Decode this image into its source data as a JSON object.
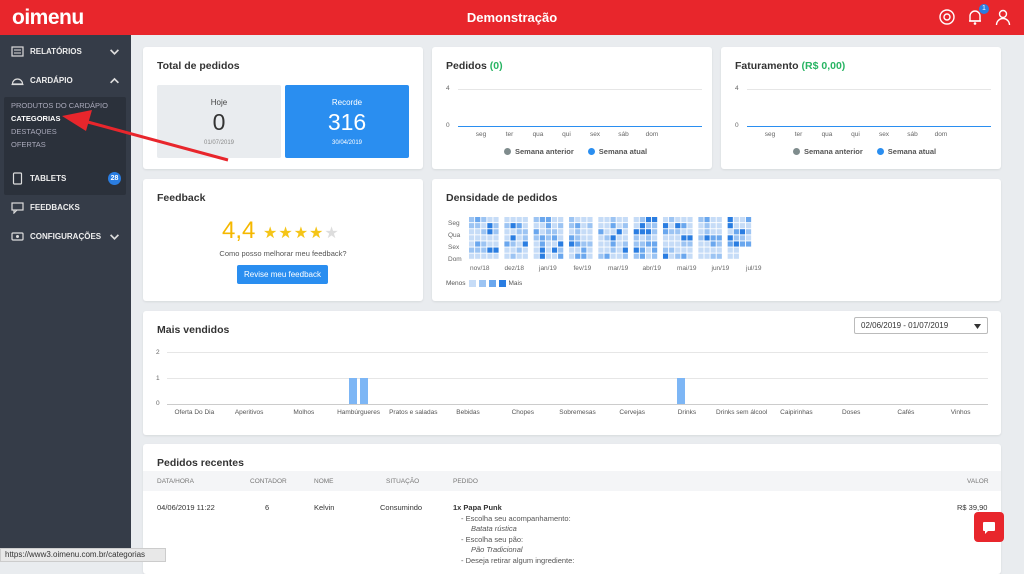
{
  "app": {
    "logo": "oimenu",
    "title": "Demonstração",
    "notification_count": "1"
  },
  "sidebar": {
    "relatorios": "RELATÓRIOS",
    "cardapio": "CARDÁPIO",
    "sub_items": [
      "PRODUTOS DO CARDÁPIO",
      "CATEGORIAS",
      "DESTAQUES",
      "OFERTAS"
    ],
    "tablets": "TABLETS",
    "tablets_badge": "28",
    "feedbacks": "FEEDBACKS",
    "configuracoes": "CONFIGURAÇÕES"
  },
  "total_pedidos": {
    "title": "Total de pedidos",
    "hoje": {
      "label": "Hoje",
      "value": "0",
      "date": "01/07/2019"
    },
    "recorde": {
      "label": "Recorde",
      "value": "316",
      "date": "30/04/2019"
    }
  },
  "pedidos": {
    "title": "Pedidos",
    "count": "(0)",
    "y_top": "4",
    "y_bottom": "0",
    "days": [
      "seg",
      "ter",
      "qua",
      "qui",
      "sex",
      "sáb",
      "dom"
    ],
    "legend": [
      "Semana anterior",
      "Semana atual"
    ]
  },
  "faturamento": {
    "title": "Faturamento",
    "value": "(R$ 0,00)",
    "y_top": "4",
    "y_bottom": "0",
    "days": [
      "seg",
      "ter",
      "qua",
      "qui",
      "sex",
      "sáb",
      "dom"
    ],
    "legend": [
      "Semana anterior",
      "Semana atual"
    ]
  },
  "feedback": {
    "title": "Feedback",
    "score": "4,4",
    "rating": 4.4,
    "prompt": "Como posso melhorar meu feedback?",
    "button": "Revise meu feedback"
  },
  "densidade": {
    "title": "Densidade de pedidos",
    "rows": [
      "Seg",
      "Qua",
      "Sex",
      "Dom"
    ],
    "months": [
      "nov/18",
      "dez/18",
      "jan/19",
      "fev/19",
      "mar/19",
      "abr/19",
      "mai/19",
      "jun/19",
      "jul/19"
    ],
    "legend_less": "Menos",
    "legend_more": "Mais"
  },
  "mais_vendidos": {
    "title": "Mais vendidos",
    "date_range": "02/06/2019 - 01/07/2019",
    "y_ticks": [
      "2",
      "1",
      "0"
    ],
    "categories": [
      "Oferta Do Dia",
      "Aperitivos",
      "Molhos",
      "Hambúrgueres",
      "Pratos e saladas",
      "Bebidas",
      "Chopes",
      "Sobremesas",
      "Cervejas",
      "Drinks",
      "Drinks sem álcool",
      "Caipirinhas",
      "Doses",
      "Cafés",
      "Vinhos"
    ]
  },
  "chart_data": {
    "type": "bar",
    "categories": [
      "Oferta Do Dia",
      "Aperitivos",
      "Molhos",
      "Hambúrgueres",
      "Pratos e saladas",
      "Bebidas",
      "Chopes",
      "Sobremesas",
      "Cervejas",
      "Drinks",
      "Drinks sem álcool",
      "Caipirinhas",
      "Doses",
      "Cafés",
      "Vinhos"
    ],
    "series": [
      {
        "values": [
          0,
          0,
          0,
          1,
          0,
          0,
          0,
          0,
          0,
          1,
          0,
          0,
          0,
          0,
          0
        ]
      },
      {
        "values": [
          0,
          0,
          0,
          1,
          0,
          0,
          0,
          0,
          0,
          0,
          0,
          0,
          0,
          0,
          0
        ]
      }
    ],
    "ylim": [
      0,
      2
    ]
  },
  "pedidos_recentes": {
    "title": "Pedidos recentes",
    "headers": [
      "DATA/HORA",
      "CONTADOR",
      "NOME",
      "SITUAÇÃO",
      "PEDIDO",
      "VALOR"
    ],
    "row": {
      "datetime": "04/06/2019 11:22",
      "counter": "6",
      "name": "Kelvin",
      "status": "Consumindo",
      "item": "1x Papa Punk",
      "opt1": "- Escolha seu acompanhamento:",
      "val1": "Batata rústica",
      "opt2": "- Escolha seu pão:",
      "val2": "Pão Tradicional",
      "opt3": "- Deseja retirar algum ingrediente:",
      "value": "R$ 39,90"
    }
  },
  "status_url": "https://www3.oimenu.com.br/categorias",
  "colors": {
    "brand": "#e8262c",
    "sidebar": "#353c48",
    "accent": "#2a8ef0",
    "prev_week": "#7f8c8d",
    "curr_week": "#2a8ef0"
  }
}
